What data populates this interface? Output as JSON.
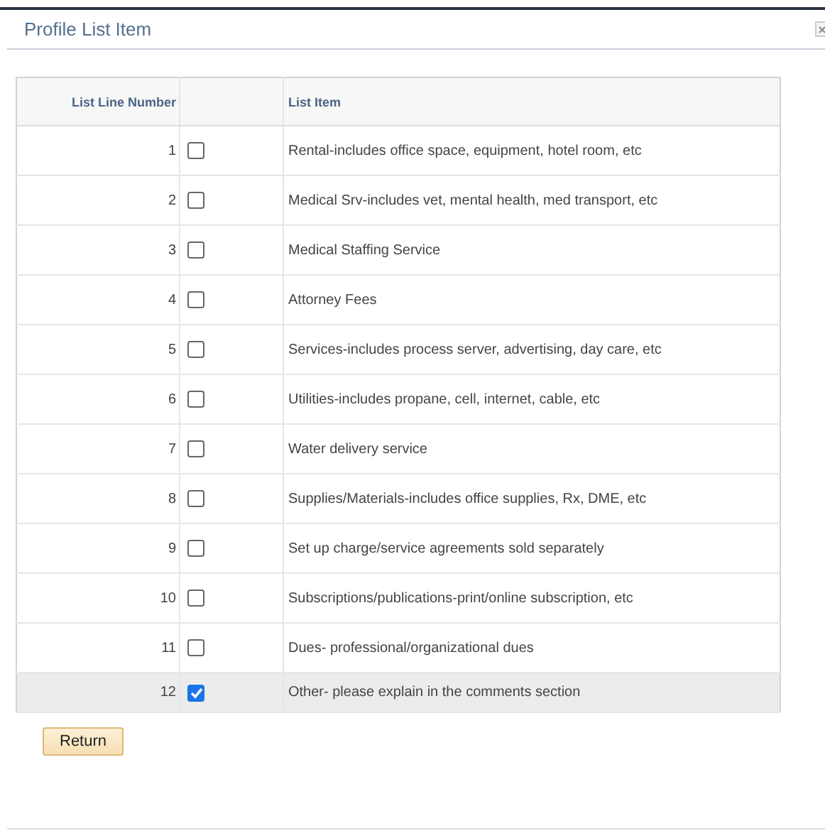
{
  "dialog": {
    "title": "Profile List Item"
  },
  "table": {
    "columns": [
      "List Line Number",
      "List Item"
    ],
    "rows": [
      {
        "number": "1",
        "item": "Rental-includes office space, equipment, hotel room, etc",
        "checked": false,
        "selected": false
      },
      {
        "number": "2",
        "item": "Medical Srv-includes vet, mental health, med transport, etc",
        "checked": false,
        "selected": false
      },
      {
        "number": "3",
        "item": "Medical Staffing Service",
        "checked": false,
        "selected": false
      },
      {
        "number": "4",
        "item": "Attorney Fees",
        "checked": false,
        "selected": false
      },
      {
        "number": "5",
        "item": "Services-includes process server, advertising, day care, etc",
        "checked": false,
        "selected": false
      },
      {
        "number": "6",
        "item": "Utilities-includes propane, cell, internet, cable, etc",
        "checked": false,
        "selected": false
      },
      {
        "number": "7",
        "item": "Water delivery service",
        "checked": false,
        "selected": false
      },
      {
        "number": "8",
        "item": "Supplies/Materials-includes office supplies, Rx, DME, etc",
        "checked": false,
        "selected": false
      },
      {
        "number": "9",
        "item": "Set up charge/service agreements sold separately",
        "checked": false,
        "selected": false
      },
      {
        "number": "10",
        "item": "Subscriptions/publications-print/online subscription, etc",
        "checked": false,
        "selected": false
      },
      {
        "number": "11",
        "item": "Dues- professional/organizational dues",
        "checked": false,
        "selected": false
      },
      {
        "number": "12",
        "item": "Other- please explain in the comments section",
        "checked": true,
        "selected": true
      }
    ]
  },
  "buttons": [
    "Return"
  ]
}
